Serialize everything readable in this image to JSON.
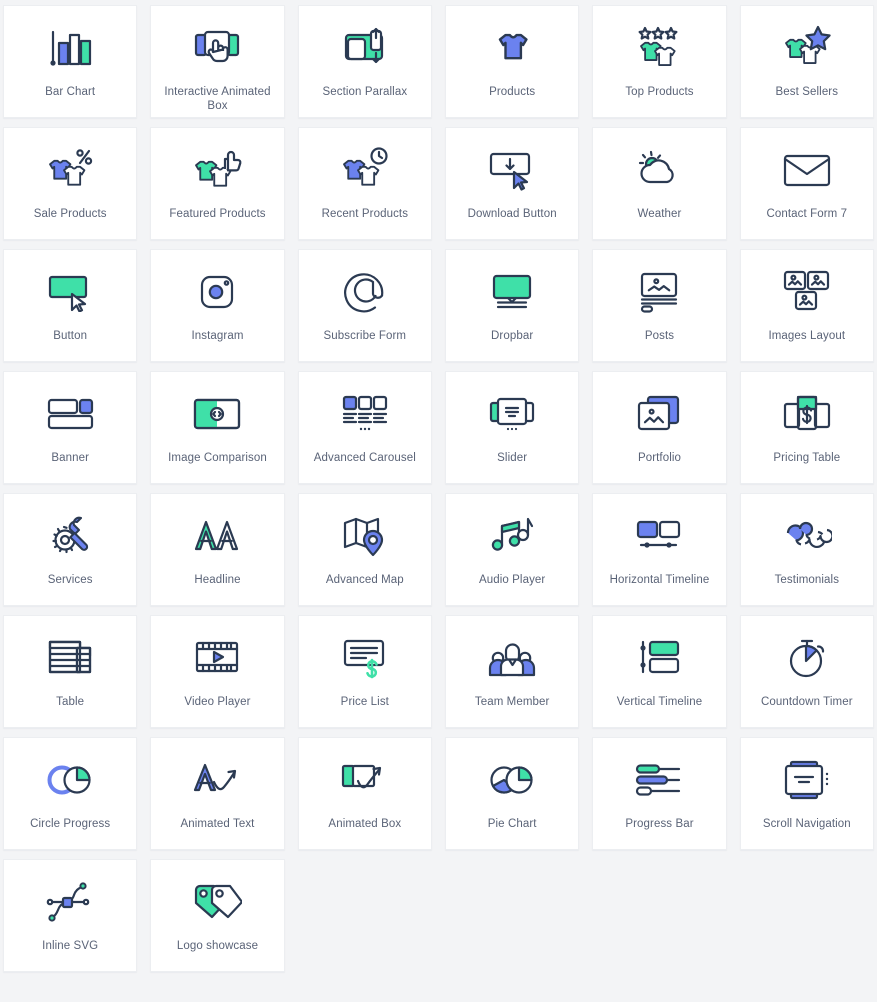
{
  "theme": {
    "page_background": "#f3f4f6",
    "card_background": "#ffffff",
    "card_border": "#eceef1",
    "label_color": "#5a6377",
    "accent_green": "#3fe0a8",
    "accent_blue": "#6b82ef",
    "icon_stroke": "#2b3a52"
  },
  "grid": {
    "columns": 6,
    "total_widgets": 44,
    "widgets": [
      {
        "label": "Bar Chart",
        "icon": "bar-chart-icon"
      },
      {
        "label": "Interactive Animated Box",
        "icon": "interactive-animated-box-icon"
      },
      {
        "label": "Section Parallax",
        "icon": "section-parallax-icon"
      },
      {
        "label": "Products",
        "icon": "tshirt-icon"
      },
      {
        "label": "Top Products",
        "icon": "top-products-stars-icon"
      },
      {
        "label": "Best Sellers",
        "icon": "best-sellers-star-icon"
      },
      {
        "label": "Sale Products",
        "icon": "sale-percent-icon"
      },
      {
        "label": "Featured Products",
        "icon": "thumbs-up-icon"
      },
      {
        "label": "Recent Products",
        "icon": "clock-shirt-icon"
      },
      {
        "label": "Download Button",
        "icon": "download-button-icon"
      },
      {
        "label": "Weather",
        "icon": "weather-cloud-sun-icon"
      },
      {
        "label": "Contact Form 7",
        "icon": "envelope-icon"
      },
      {
        "label": "Button",
        "icon": "button-cursor-icon"
      },
      {
        "label": "Instagram",
        "icon": "instagram-camera-icon"
      },
      {
        "label": "Subscribe Form",
        "icon": "at-sign-icon"
      },
      {
        "label": "Dropbar",
        "icon": "dropbar-screen-icon"
      },
      {
        "label": "Posts",
        "icon": "posts-image-lines-icon"
      },
      {
        "label": "Images Layout",
        "icon": "images-layout-icon"
      },
      {
        "label": "Banner",
        "icon": "banner-blocks-icon"
      },
      {
        "label": "Image Comparison",
        "icon": "image-comparison-icon"
      },
      {
        "label": "Advanced Carousel",
        "icon": "advanced-carousel-icon"
      },
      {
        "label": "Slider",
        "icon": "slider-cards-icon"
      },
      {
        "label": "Portfolio",
        "icon": "portfolio-stack-icon"
      },
      {
        "label": "Pricing Table",
        "icon": "pricing-table-dollar-icon"
      },
      {
        "label": "Services",
        "icon": "gear-wrench-icon"
      },
      {
        "label": "Headline",
        "icon": "double-a-icon"
      },
      {
        "label": "Advanced Map",
        "icon": "map-pin-icon"
      },
      {
        "label": "Audio Player",
        "icon": "music-note-icon"
      },
      {
        "label": "Horizontal Timeline",
        "icon": "horizontal-timeline-icon"
      },
      {
        "label": "Testimonials",
        "icon": "quote-marks-icon"
      },
      {
        "label": "Table",
        "icon": "table-grid-icon"
      },
      {
        "label": "Video Player",
        "icon": "film-play-icon"
      },
      {
        "label": "Price List",
        "icon": "price-list-dollar-icon"
      },
      {
        "label": "Team Member",
        "icon": "team-people-icon"
      },
      {
        "label": "Vertical Timeline",
        "icon": "vertical-timeline-icon"
      },
      {
        "label": "Countdown Timer",
        "icon": "stopwatch-icon"
      },
      {
        "label": "Circle Progress",
        "icon": "circle-progress-icon"
      },
      {
        "label": "Animated Text",
        "icon": "animated-text-arrow-icon"
      },
      {
        "label": "Animated Box",
        "icon": "animated-box-arrow-icon"
      },
      {
        "label": "Pie Chart",
        "icon": "pie-chart-icon"
      },
      {
        "label": "Progress Bar",
        "icon": "progress-bars-icon"
      },
      {
        "label": "Scroll Navigation",
        "icon": "scroll-navigation-icon"
      },
      {
        "label": "Inline SVG",
        "icon": "inline-svg-node-icon"
      },
      {
        "label": "Logo showcase",
        "icon": "tags-logo-icon"
      }
    ]
  }
}
